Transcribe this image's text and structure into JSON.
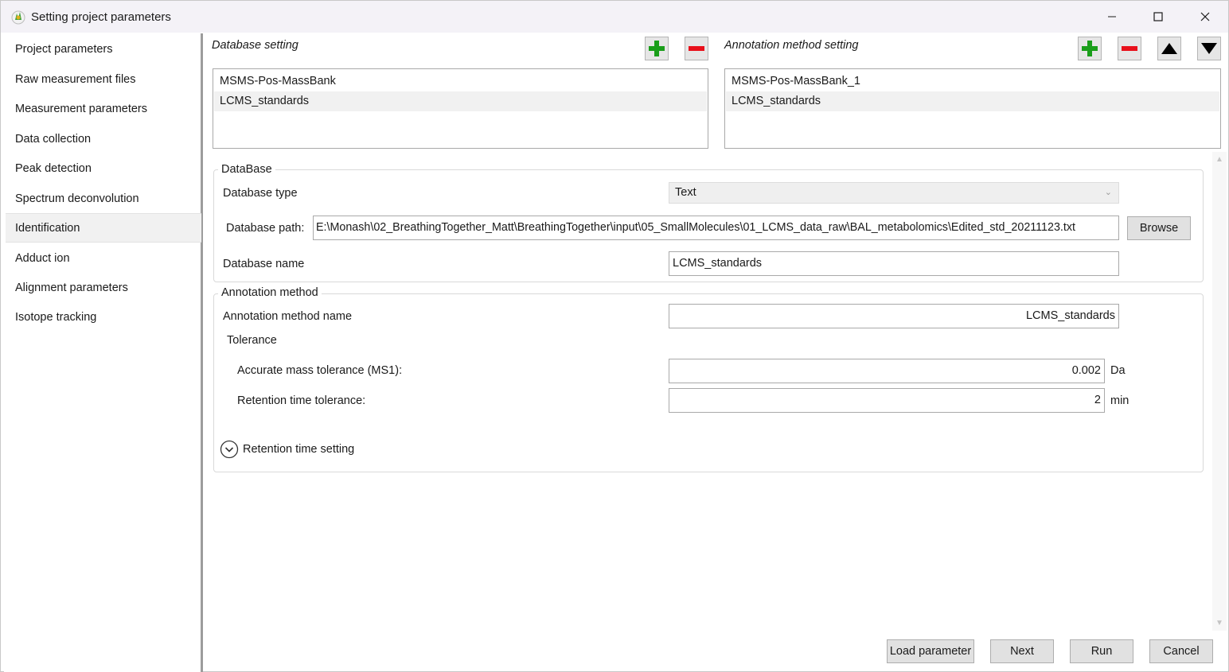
{
  "window": {
    "title": "Setting project parameters",
    "icons": {
      "app": "msdial-app-icon",
      "minimize": "minimize-icon",
      "maximize": "maximize-icon",
      "close": "close-icon"
    }
  },
  "sidebar": {
    "items": [
      {
        "label": "Project parameters",
        "selected": false
      },
      {
        "label": "Raw measurement files",
        "selected": false
      },
      {
        "label": "Measurement parameters",
        "selected": false
      },
      {
        "label": "Data collection",
        "selected": false
      },
      {
        "label": "Peak detection",
        "selected": false
      },
      {
        "label": "Spectrum deconvolution",
        "selected": false
      },
      {
        "label": "Identification",
        "selected": true
      },
      {
        "label": "Adduct ion",
        "selected": false
      },
      {
        "label": "Alignment parameters",
        "selected": false
      },
      {
        "label": "Isotope tracking",
        "selected": false
      }
    ]
  },
  "database_setting": {
    "label": "Database setting",
    "list": [
      "MSMS-Pos-MassBank",
      "LCMS_standards"
    ],
    "selected_index": 1
  },
  "annotation_setting": {
    "label": "Annotation method setting",
    "list": [
      "MSMS-Pos-MassBank_1",
      "LCMS_standards"
    ],
    "selected_index": 1
  },
  "database_group": {
    "title": "DataBase",
    "type_label": "Database type",
    "type_value": "Text",
    "path_label": "Database path:",
    "path_value": "E:\\Monash\\02_BreathingTogether_Matt\\BreathingTogether\\input\\05_SmallMolecules\\01_LCMS_data_raw\\BAL_metabolomics\\Edited_std_20211123.txt",
    "browse_label": "Browse",
    "name_label": "Database name",
    "name_value": "LCMS_standards"
  },
  "annotation_group": {
    "title": "Annotation method",
    "name_label": "Annotation method name",
    "name_value": "LCMS_standards",
    "tolerance_label": "Tolerance",
    "ms1_label": "Accurate mass tolerance (MS1):",
    "ms1_value": "0.002",
    "ms1_unit": "Da",
    "rt_label": "Retention time tolerance:",
    "rt_value": "2",
    "rt_unit": "min",
    "rt_setting_label": "Retention time setting"
  },
  "footer": {
    "load_label": "Load parameter",
    "next_label": "Next",
    "run_label": "Run",
    "cancel_label": "Cancel"
  },
  "colors": {
    "add_green": "#1a9e1a",
    "remove_red": "#e8101a"
  }
}
